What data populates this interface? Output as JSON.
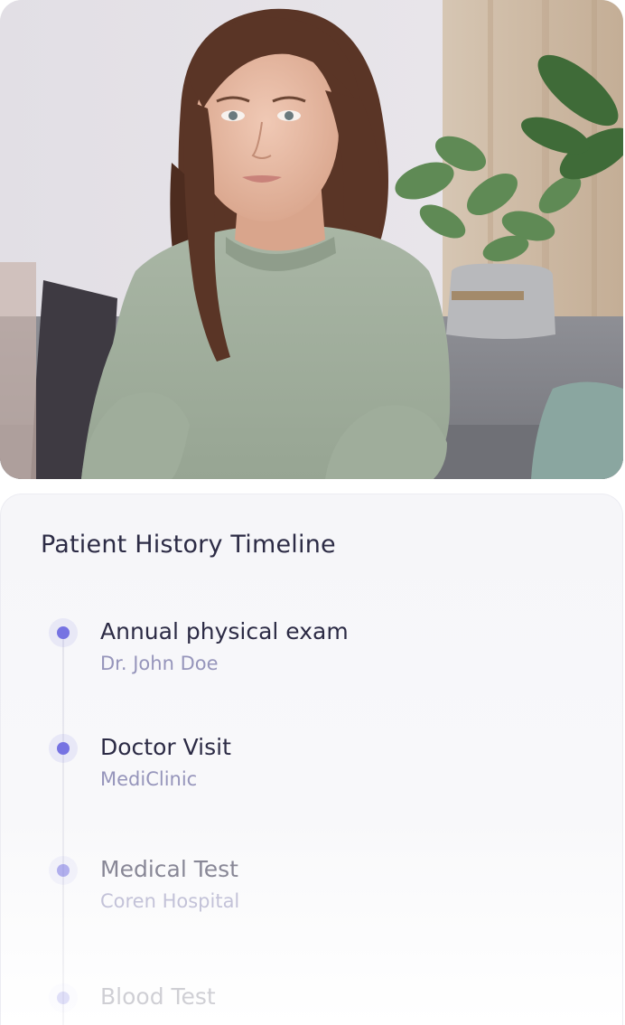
{
  "photo": {
    "subject": "patient-portrait"
  },
  "timeline": {
    "title": "Patient History Timeline",
    "accent_color": "#7673e2",
    "items": [
      {
        "title": "Annual physical exam",
        "subtitle": "Dr. John Doe"
      },
      {
        "title": "Doctor Visit",
        "subtitle": "MediClinic"
      },
      {
        "title": "Medical Test",
        "subtitle": "Coren Hospital"
      },
      {
        "title": "Blood Test",
        "subtitle": ""
      }
    ]
  }
}
